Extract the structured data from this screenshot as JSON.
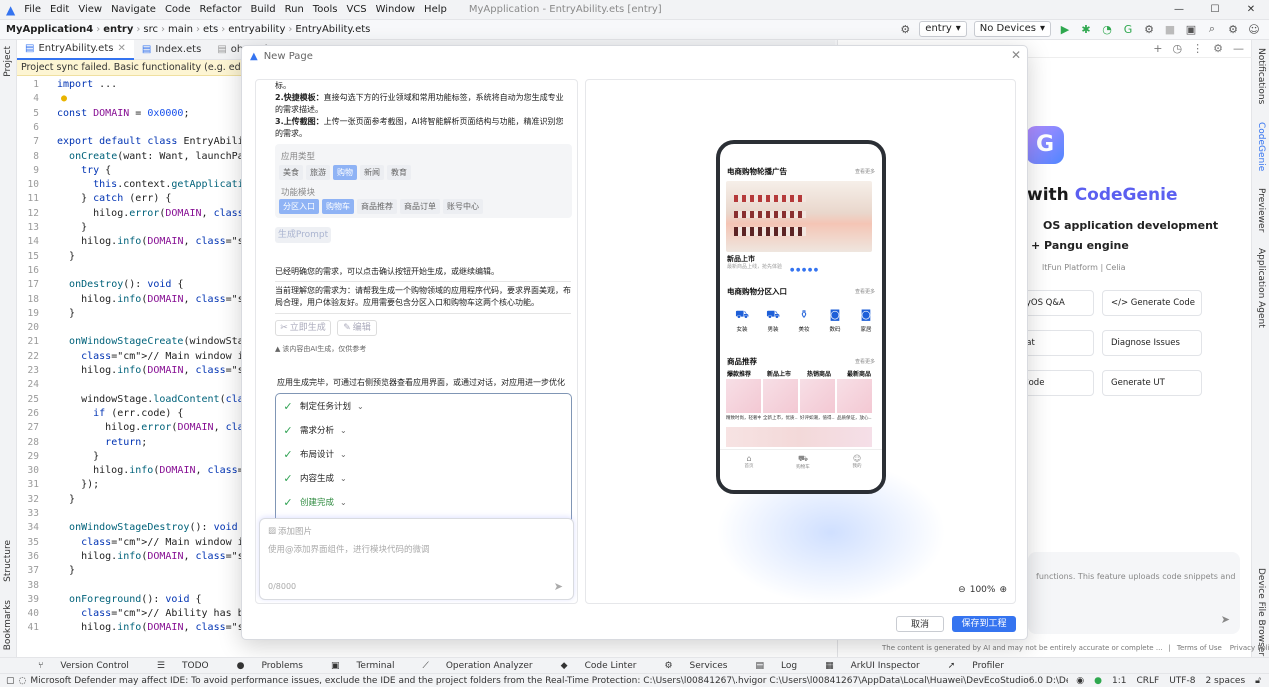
{
  "menubar": {
    "items": [
      "File",
      "Edit",
      "View",
      "Navigate",
      "Code",
      "Refactor",
      "Build",
      "Run",
      "Tools",
      "VCS",
      "Window",
      "Help"
    ],
    "title": "MyApplication - EntryAbility.ets [entry]"
  },
  "navbar": {
    "project": "MyApplication4",
    "module": "entry",
    "crumbs": [
      "src",
      "main",
      "ets",
      "entryability",
      "EntryAbility.ets"
    ],
    "run_config": "entry",
    "device": "No Devices"
  },
  "tabs": [
    "EntryAbility.ets",
    "Index.ets",
    "oh-package"
  ],
  "sync_banner": "Project sync failed. Basic functionality (e.g. editing, debug",
  "left_strip": {
    "project": "Project",
    "structure": "Structure",
    "bookmarks": "Bookmarks"
  },
  "right_strip": [
    "Notifications",
    "CodeGenie",
    "Previewer",
    "Application Agent",
    "Device File Browser"
  ],
  "editor": {
    "lines": [
      {
        "n": "1",
        "t": "import ..."
      },
      {
        "n": "4",
        "t": ""
      },
      {
        "n": "5",
        "t": "const DOMAIN = 0x0000;"
      },
      {
        "n": "6",
        "t": ""
      },
      {
        "n": "7",
        "t": "export default class EntryAbility e"
      },
      {
        "n": "8",
        "t": "  onCreate(want: Want, launchParam"
      },
      {
        "n": "9",
        "t": "    try {"
      },
      {
        "n": "10",
        "t": "      this.context.getApplicationCo"
      },
      {
        "n": "11",
        "t": "    } catch (err) {"
      },
      {
        "n": "12",
        "t": "      hilog.error(DOMAIN, 'testTag"
      },
      {
        "n": "13",
        "t": "    }"
      },
      {
        "n": "14",
        "t": "    hilog.info(DOMAIN, 'testTag',"
      },
      {
        "n": "15",
        "t": "  }"
      },
      {
        "n": "16",
        "t": ""
      },
      {
        "n": "17",
        "t": "  onDestroy(): void {"
      },
      {
        "n": "18",
        "t": "    hilog.info(DOMAIN, 'testTag',"
      },
      {
        "n": "19",
        "t": "  }"
      },
      {
        "n": "20",
        "t": ""
      },
      {
        "n": "21",
        "t": "  onWindowStageCreate(windowStage:"
      },
      {
        "n": "22",
        "t": "    // Main window is created, set"
      },
      {
        "n": "23",
        "t": "    hilog.info(DOMAIN, 'testTag',"
      },
      {
        "n": "24",
        "t": ""
      },
      {
        "n": "25",
        "t": "    windowStage.loadContent('pages"
      },
      {
        "n": "26",
        "t": "      if (err.code) {"
      },
      {
        "n": "27",
        "t": "        hilog.error(DOMAIN, 'testTa"
      },
      {
        "n": "28",
        "t": "        return;"
      },
      {
        "n": "29",
        "t": "      }"
      },
      {
        "n": "30",
        "t": "      hilog.info(DOMAIN, 'testTag'"
      },
      {
        "n": "31",
        "t": "    });"
      },
      {
        "n": "32",
        "t": "  }"
      },
      {
        "n": "33",
        "t": ""
      },
      {
        "n": "34",
        "t": "  onWindowStageDestroy(): void {"
      },
      {
        "n": "35",
        "t": "    // Main window is destroyed, r"
      },
      {
        "n": "36",
        "t": "    hilog.info(DOMAIN, 'testTag',"
      },
      {
        "n": "37",
        "t": "  }"
      },
      {
        "n": "38",
        "t": ""
      },
      {
        "n": "39",
        "t": "  onForeground(): void {"
      },
      {
        "n": "40",
        "t": "    // Ability has brought to fore"
      },
      {
        "n": "41",
        "t": "    hilog.info(DOMAIN, 'testTag',"
      }
    ]
  },
  "genie": {
    "headline_prefix": "with ",
    "headline_brand": "CodeGenie",
    "sub1": "OS application development",
    "sub2": "+ Pangu engine",
    "sub3": "ltFun Platform | Celia",
    "actions": [
      "monyOS Q&A",
      "</> Generate Code",
      "e Chat",
      "Diagnose Issues",
      "ain Code",
      "Generate UT"
    ],
    "input_hint": "functions. This feature uploads code snippets and",
    "footer": "The content is generated by AI and may not be entirely accurate or complete ...",
    "terms": "Terms of Use",
    "privacy": "Privacy Policy"
  },
  "modal": {
    "title": "New Page",
    "intro1": "标。",
    "intro2_bold": "2.快捷模板：",
    "intro2": "直接勾选下方的行业领域和常用功能标签，系统将自动为您生成专业的需求描述。",
    "intro3_bold": "3.上传截图：",
    "intro3": "上传一张页面参考截图，AI将智能解析页面结构与功能，精准识别您的需求。",
    "app_type_label": "应用类型",
    "app_types": [
      {
        "t": "美食",
        "sel": false
      },
      {
        "t": "旅游",
        "sel": false
      },
      {
        "t": "购物",
        "sel": true
      },
      {
        "t": "新闻",
        "sel": false
      },
      {
        "t": "教育",
        "sel": false
      }
    ],
    "feature_label": "功能模块",
    "features": [
      {
        "t": "分区入口",
        "sel": true
      },
      {
        "t": "购物车",
        "sel": true
      },
      {
        "t": "商品推荐",
        "sel": false
      },
      {
        "t": "商品订单",
        "sel": false
      },
      {
        "t": "账号中心",
        "sel": false
      }
    ],
    "gen_prompt_btn": "生成Prompt",
    "confirm_text": "已经明确您的需求，可以点击确认按钮开始生成，或继续编辑。",
    "understood_text": "当前理解您的需求为：请帮我生成一个购物领域的应用程序代码，要求界面美观，布局合理，用户体验友好。应用需要包含分区入口和购物车这两个核心功能。",
    "gen_now_btn": "立即生成",
    "edit_btn": "编辑",
    "ai_note": "该内容由AI生成，仅供参考",
    "done_text": "应用生成完毕，可通过右侧预览器查看应用界面，或通过对话，对应用进一步优化",
    "steps": [
      "制定任务计划",
      "需求分析",
      "布局设计",
      "内容生成",
      "创建完成"
    ],
    "add_image": "添加图片",
    "input_placeholder": "使用@添加界面组件，进行模块代码的微调",
    "counter": "0/8000",
    "zoom": "100%",
    "cancel": "取消",
    "save": "保存到工程"
  },
  "phone": {
    "banner_title": "电商购物轮播广告",
    "more": "查看更多",
    "new_title": "新品上市",
    "new_sub": "最新商品上线，抢先体验",
    "cat_title": "电商购物分区入口",
    "cats": [
      "女装",
      "男装",
      "美妆",
      "数码",
      "家居"
    ],
    "rec_title": "商品推荐",
    "rec_tabs": [
      "爆款推荐",
      "新品上市",
      "热销商品",
      "最新商品"
    ],
    "cards": [
      "精致时尚，轻奢中",
      "全新上市，优质...",
      "好评如潮，值得...",
      "品质保证，放心..."
    ],
    "nav": [
      "首页",
      "购物车",
      "我的"
    ]
  },
  "toolwin": [
    "Version Control",
    "TODO",
    "Problems",
    "Terminal",
    "Operation Analyzer",
    "Code Linter",
    "Services",
    "Log",
    "ArkUI Inspector",
    "Profiler"
  ],
  "status": {
    "msg": "Microsoft Defender may affect IDE: To avoid performance issues, exclude the IDE and the project folders from the Real-Time Protection: C:\\Users\\l00841267\\.hvigor C:\\Users\\l00841267\\AppData\\Local\\Huawei\\DevEcoStudio6.0 D:\\DevEco Studio\\deveco-studio-6.0.0.84...",
    "pos": "1:1",
    "eol": "CRLF",
    "enc": "UTF-8",
    "indent": "2 spaces"
  }
}
